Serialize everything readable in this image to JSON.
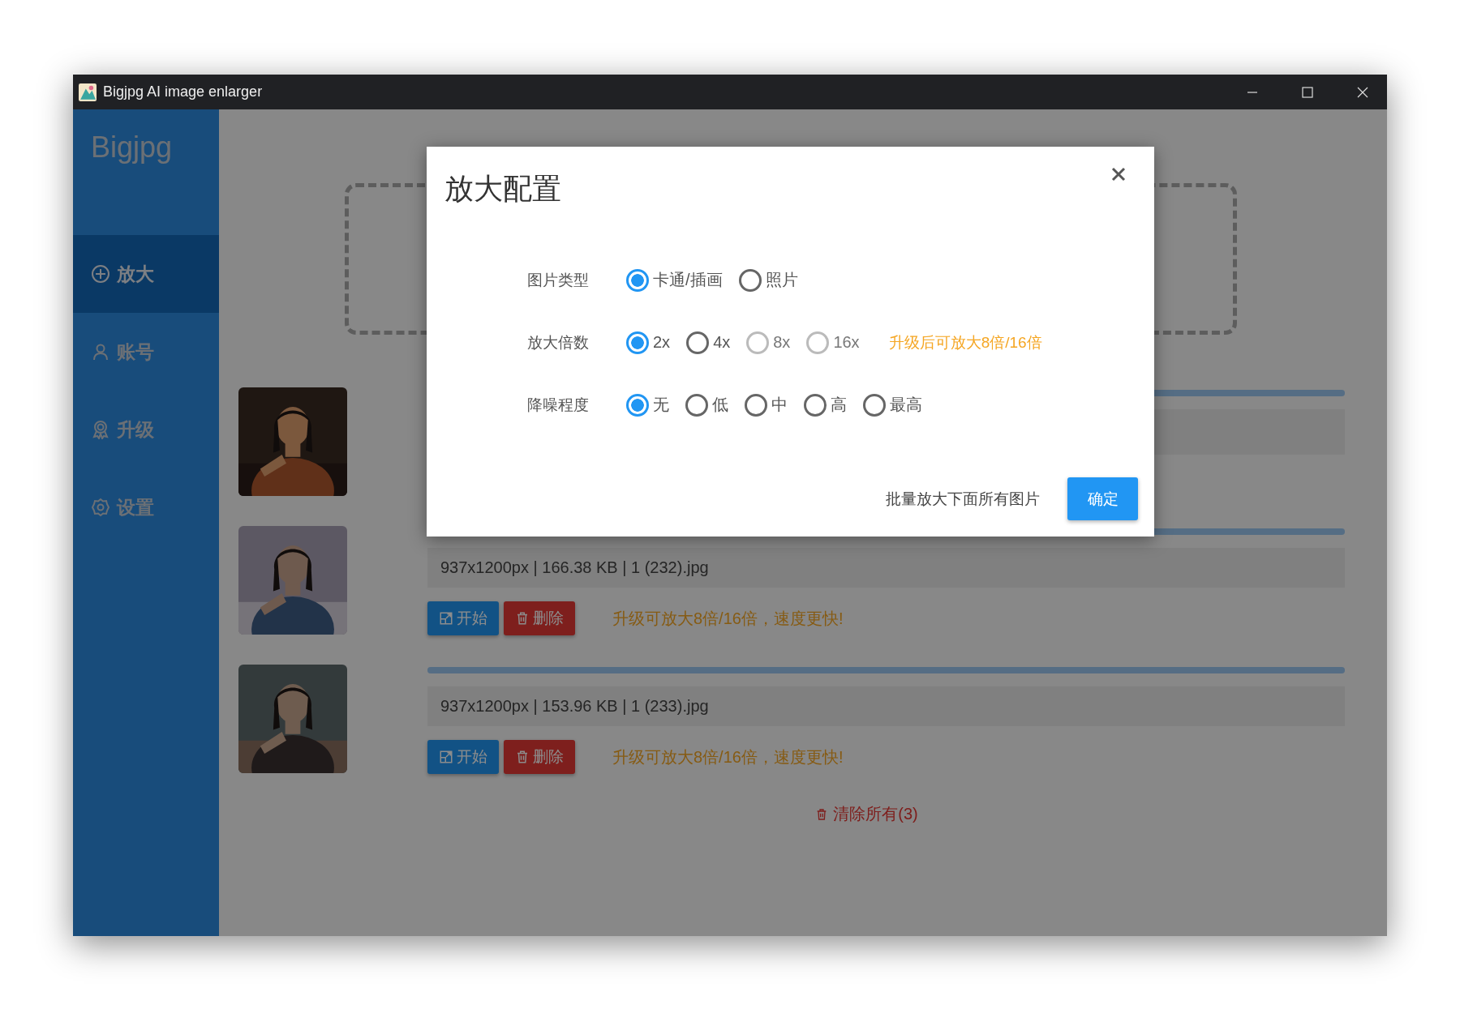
{
  "window": {
    "title": "Bigjpg AI image enlarger"
  },
  "sidebar": {
    "logo": "Bigjpg",
    "items": [
      {
        "label": "放大",
        "selected": true
      },
      {
        "label": "账号",
        "selected": false
      },
      {
        "label": "升级",
        "selected": false
      },
      {
        "label": "设置",
        "selected": false
      }
    ]
  },
  "files": [
    {
      "kind": "covered",
      "level": 1
    },
    {
      "kind": "full",
      "level": 1,
      "info": "937x1200px | 166.38 KB | 1 (232).jpg",
      "start": "开始",
      "delete": "删除",
      "note": "升级可放大8倍/16倍，速度更快!"
    },
    {
      "kind": "full",
      "level": 1,
      "info": "937x1200px | 153.96 KB | 1 (233).jpg",
      "start": "开始",
      "delete": "删除",
      "note": "升级可放大8倍/16倍，速度更快!"
    }
  ],
  "clear_all": "清除所有(3)",
  "dialog": {
    "title": "放大配置",
    "groups": [
      {
        "label": "图片类型",
        "options": [
          {
            "label": "卡通/插画",
            "selected": true,
            "disabled": false
          },
          {
            "label": "照片",
            "selected": false,
            "disabled": false
          }
        ]
      },
      {
        "label": "放大倍数",
        "options": [
          {
            "label": "2x",
            "selected": true,
            "disabled": false
          },
          {
            "label": "4x",
            "selected": false,
            "disabled": false
          },
          {
            "label": "8x",
            "selected": false,
            "disabled": true
          },
          {
            "label": "16x",
            "selected": false,
            "disabled": true
          }
        ],
        "note": "升级后可放大8倍/16倍"
      },
      {
        "label": "降噪程度",
        "options": [
          {
            "label": "无",
            "selected": true,
            "disabled": false
          },
          {
            "label": "低",
            "selected": false,
            "disabled": false
          },
          {
            "label": "中",
            "selected": false,
            "disabled": false
          },
          {
            "label": "高",
            "selected": false,
            "disabled": false
          },
          {
            "label": "最高",
            "selected": false,
            "disabled": false
          }
        ]
      }
    ],
    "batch_label": "批量放大下面所有图片",
    "confirm": "确定"
  }
}
